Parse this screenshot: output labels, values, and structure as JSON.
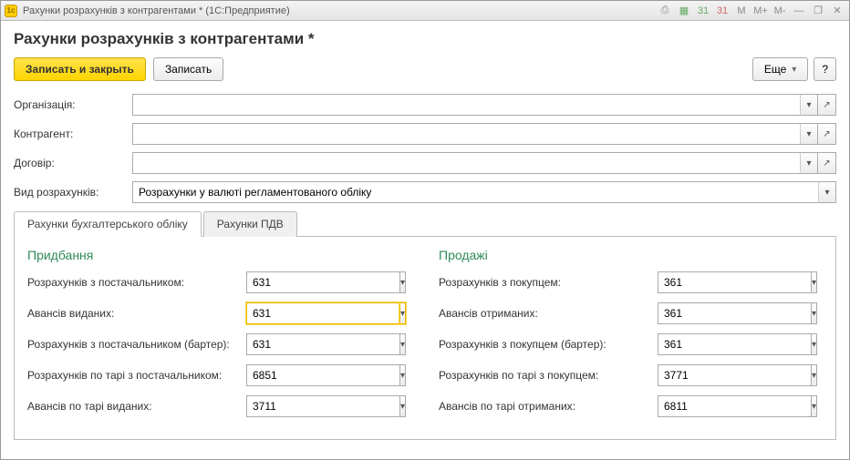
{
  "titlebar": {
    "title": "Рахунки розрахунків з контрагентами * (1С:Предприятие)",
    "icons": {
      "print": "⎙",
      "grid": "▦",
      "cal1": "31",
      "cal2": "31",
      "m": "M",
      "mplus": "M+",
      "mminus": "M-",
      "minimize": "—",
      "restore": "❐",
      "close": "✕"
    }
  },
  "page": {
    "title": "Рахунки розрахунків з контрагентами *"
  },
  "toolbar": {
    "save_close": "Записать и закрыть",
    "save": "Записать",
    "more": "Еще",
    "help": "?"
  },
  "labels": {
    "org": "Організація:",
    "contragent": "Контрагент:",
    "contract": "Договір:",
    "calc_type": "Вид розрахунків:"
  },
  "fields": {
    "org": "",
    "contragent": "",
    "contract": "",
    "calc_type": "Розрахунки у валюті регламентованого обліку"
  },
  "tabs": {
    "accounts": "Рахунки бухгалтерського обліку",
    "vat": "Рахунки ПДВ"
  },
  "sections": {
    "purchase": "Придбання",
    "sales": "Продажі"
  },
  "purchase": {
    "rows": [
      {
        "label": "Розрахунків з постачальником:",
        "value": "631"
      },
      {
        "label": "Авансів виданих:",
        "value": "631",
        "focused": true
      },
      {
        "label": "Розрахунків з постачальником (бартер):",
        "value": "631"
      },
      {
        "label": "Розрахунків по тарі з постачальником:",
        "value": "6851"
      },
      {
        "label": "Авансів по тарі виданих:",
        "value": "3711"
      }
    ]
  },
  "sales": {
    "rows": [
      {
        "label": "Розрахунків з покупцем:",
        "value": "361"
      },
      {
        "label": "Авансів отриманих:",
        "value": "361"
      },
      {
        "label": "Розрахунків з покупцем (бартер):",
        "value": "361"
      },
      {
        "label": "Розрахунків по тарі з покупцем:",
        "value": "3771"
      },
      {
        "label": "Авансів по тарі отриманих:",
        "value": "6811"
      }
    ]
  }
}
